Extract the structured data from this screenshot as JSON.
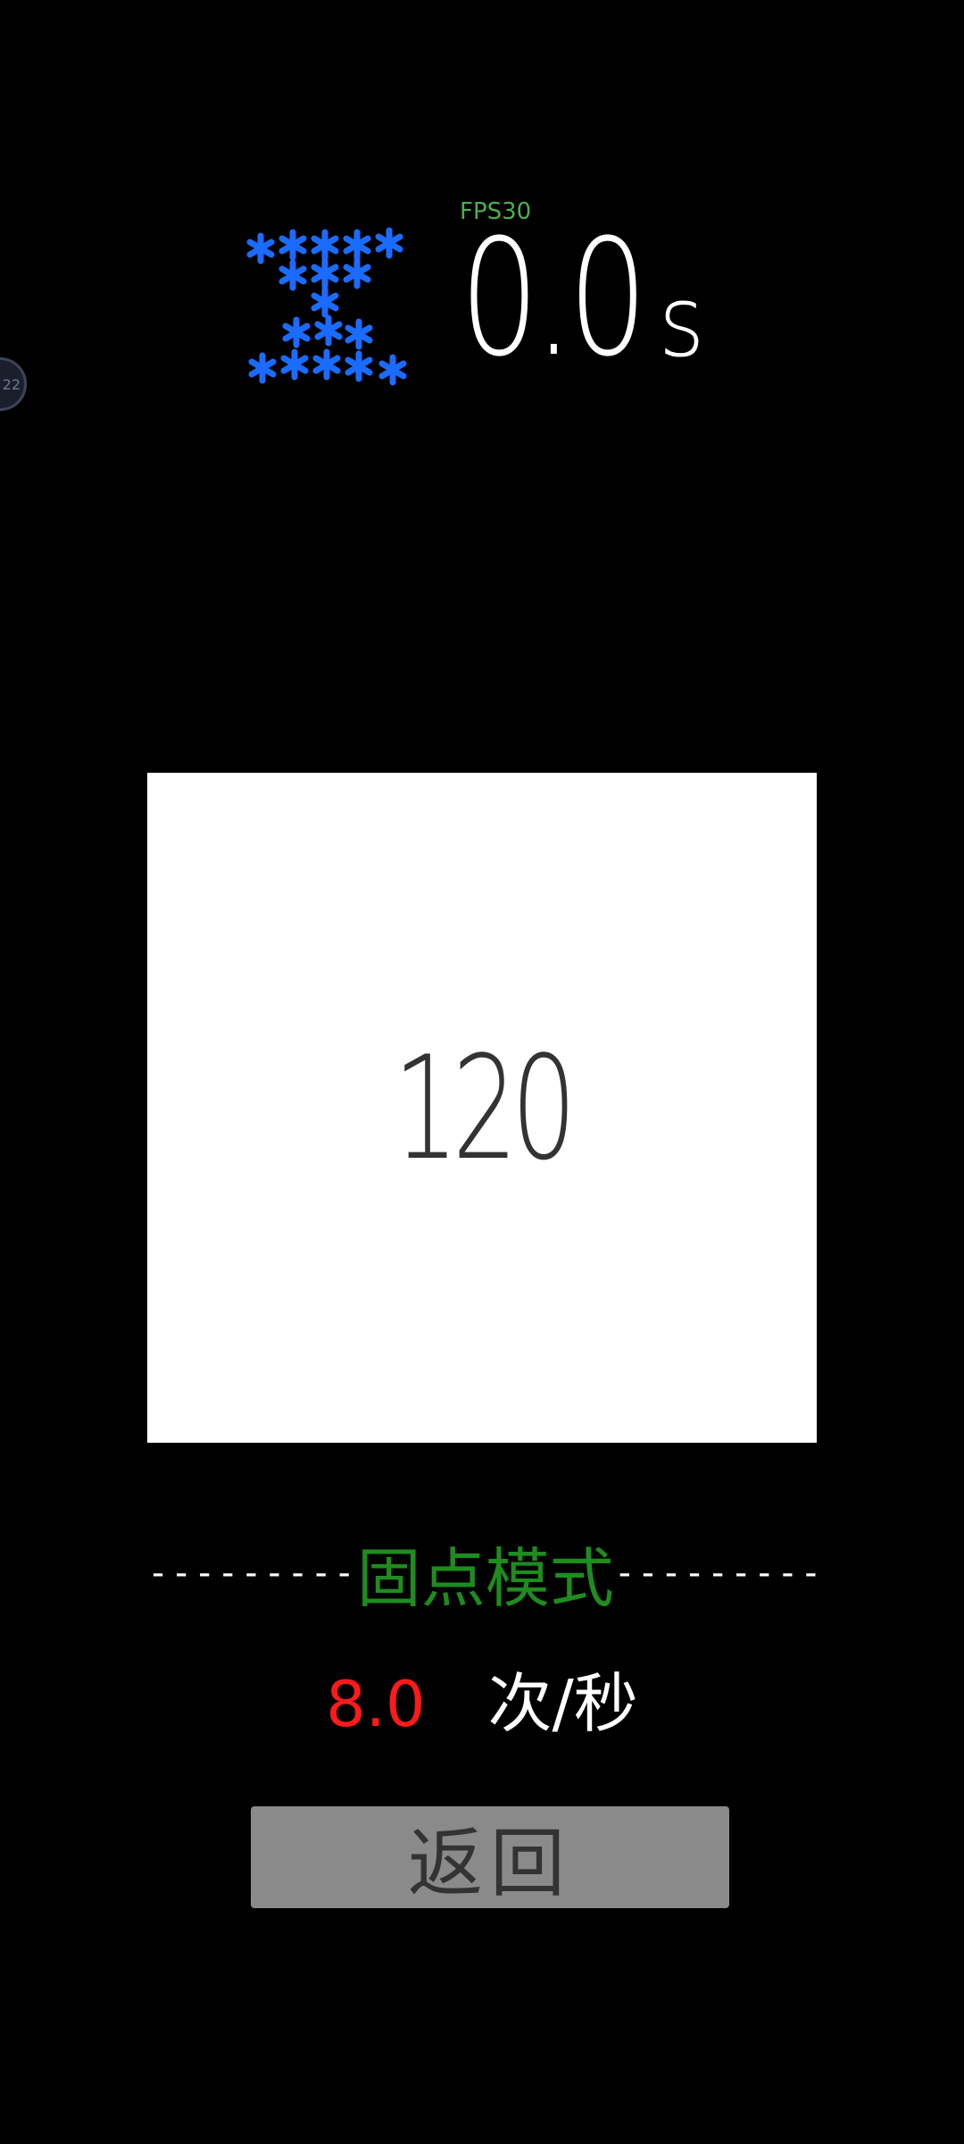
{
  "float_bubble": {
    "text": "22"
  },
  "header": {
    "fps_label": "FPS30",
    "timer_value": "0.0",
    "timer_unit": "s",
    "hourglass_icon": "hourglass-asterisk-icon",
    "hourglass_color": "#1a6cff"
  },
  "tap_area": {
    "count": "120"
  },
  "mode": {
    "left_dashes": "---------",
    "title": "固点模式",
    "right_dashes": "---------",
    "title_color": "#1e8c1e"
  },
  "rate": {
    "value": "8.0",
    "unit": "次/秒",
    "value_color": "#ff1a1a"
  },
  "back_button": {
    "label": "返回"
  }
}
